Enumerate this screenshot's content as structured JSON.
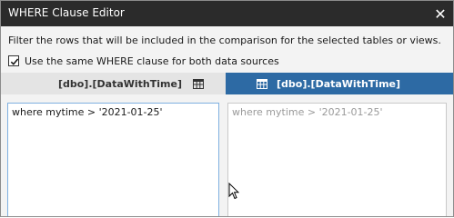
{
  "window": {
    "title": "WHERE Clause Editor",
    "close_glyph": "✕"
  },
  "description": "Filter the rows that will be included in the comparison for the selected tables or views.",
  "same_clause": {
    "label": "Use the same WHERE clause for both data sources",
    "checked": true
  },
  "sources": {
    "left": {
      "label": "[dbo].[DataWithTime]",
      "icon": "table-icon"
    },
    "right": {
      "label": "[dbo].[DataWithTime]",
      "icon": "table-icon",
      "active": true
    }
  },
  "editors": {
    "left_text": "where mytime > '2021-01-25'",
    "right_text": "where mytime > '2021-01-25'"
  },
  "colors": {
    "titlebar": "#2b2b2b",
    "active_source": "#2d6aa4",
    "focused_editor_border": "#7fb0e0"
  }
}
